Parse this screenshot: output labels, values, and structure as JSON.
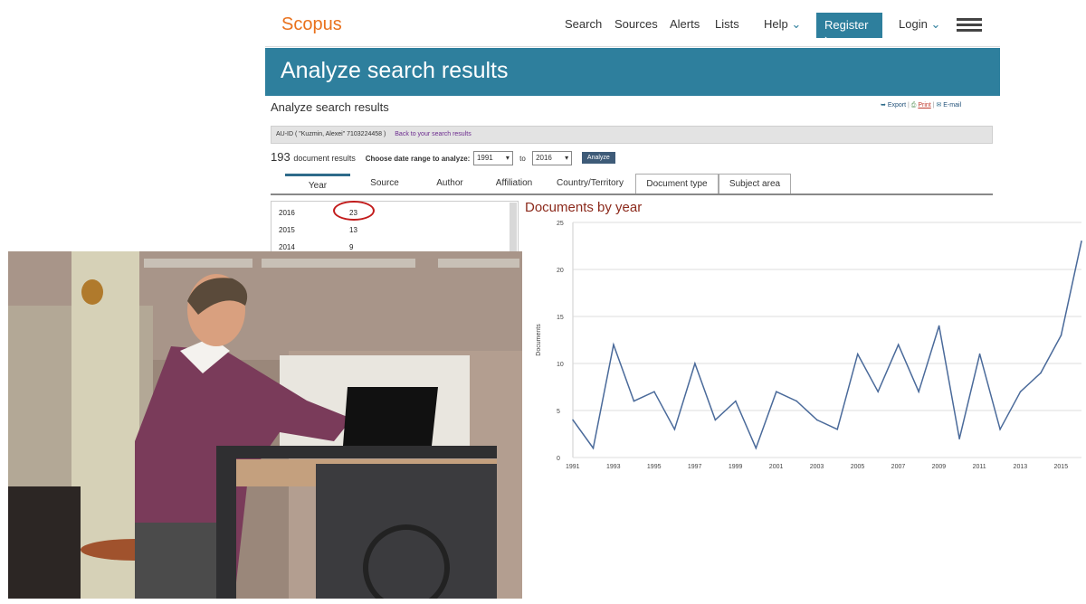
{
  "nav": {
    "logo": "Scopus",
    "links": [
      "Search",
      "Sources",
      "Alerts",
      "Lists"
    ],
    "help": "Help",
    "register": "Register",
    "login": "Login"
  },
  "banner": {
    "title": "Analyze search results"
  },
  "subheader": {
    "title": "Analyze search results",
    "export": "Export",
    "print": "Print",
    "email": "E-mail"
  },
  "query": {
    "text": "AU-ID ( \"Kuzmin, Alexei\"   7103224458 )",
    "back_link": "Back to your search results"
  },
  "results": {
    "count": "193",
    "count_label": "document results",
    "range_label": "Choose date range to analyze:",
    "from": "1991",
    "to_label": "to",
    "to": "2016",
    "analyze": "Analyze"
  },
  "tabs": [
    "Year",
    "Source",
    "Author",
    "Affiliation",
    "Country/Territory",
    "Document type",
    "Subject area"
  ],
  "year_list": [
    {
      "year": "2016",
      "count": "23"
    },
    {
      "year": "2015",
      "count": "13"
    },
    {
      "year": "2014",
      "count": "9"
    }
  ],
  "chart_data": {
    "type": "line",
    "title": "Documents by year",
    "ylabel": "Documents",
    "xlabel": "",
    "ylim": [
      0,
      25
    ],
    "yticks": [
      0,
      5,
      10,
      15,
      20,
      25
    ],
    "xtick_labels": [
      "1991",
      "1993",
      "1995",
      "1997",
      "1999",
      "2001",
      "2003",
      "2005",
      "2007",
      "2009",
      "2011",
      "2013",
      "2015"
    ],
    "x": [
      1991,
      1992,
      1993,
      1994,
      1995,
      1996,
      1997,
      1998,
      1999,
      2000,
      2001,
      2002,
      2003,
      2004,
      2005,
      2006,
      2007,
      2008,
      2009,
      2010,
      2011,
      2012,
      2013,
      2014,
      2015,
      2016
    ],
    "values": [
      4,
      1,
      12,
      6,
      7,
      3,
      10,
      4,
      6,
      1,
      7,
      6,
      4,
      3,
      11,
      7,
      12,
      7,
      14,
      2,
      11,
      3,
      7,
      9,
      13,
      23
    ],
    "grid": true,
    "line_color": "#4a6a9a"
  }
}
